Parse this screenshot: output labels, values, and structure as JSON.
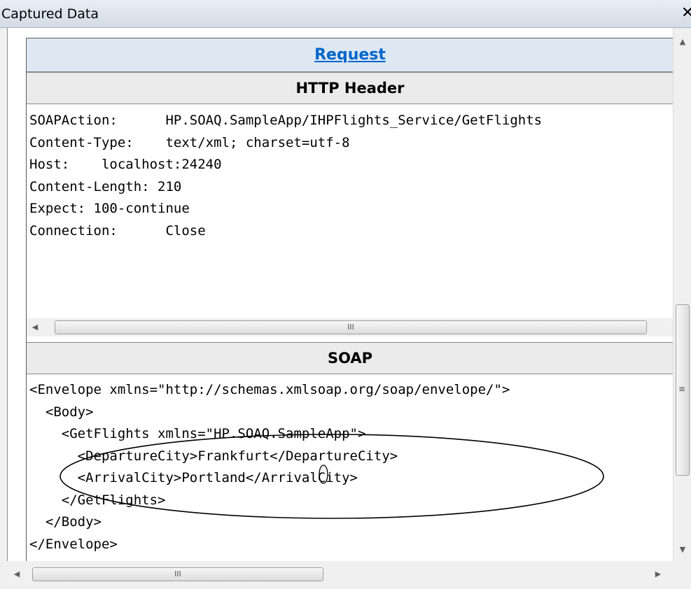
{
  "window": {
    "title": "Captured Data",
    "close_glyph": "✕"
  },
  "request": {
    "link_label": "Request"
  },
  "http_header": {
    "title": "HTTP Header",
    "lines": [
      "SOAPAction:      HP.SOAQ.SampleApp/IHPFlights_Service/GetFlights",
      "Content-Type:    text/xml; charset=utf-8",
      "Host:    localhost:24240",
      "Content-Length: 210",
      "Expect: 100-continue",
      "Connection:      Close"
    ],
    "scroll_grip": "III"
  },
  "soap": {
    "title": "SOAP",
    "lines": [
      "<Envelope xmlns=\"http://schemas.xmlsoap.org/soap/envelope/\">",
      "  <Body>",
      "    <GetFlights xmlns=\"HP.SOAQ.SampleApp\">",
      "      <DepartureCity>Frankfurt</DepartureCity>",
      "      <ArrivalCity>Portland</ArrivalCity>",
      "    </GetFlights>",
      "  </Body>",
      "</Envelope>"
    ]
  },
  "scrollbars": {
    "bottom_grip": "III",
    "vertical_grip": "≡"
  },
  "annotation": {
    "color": "#000000"
  }
}
